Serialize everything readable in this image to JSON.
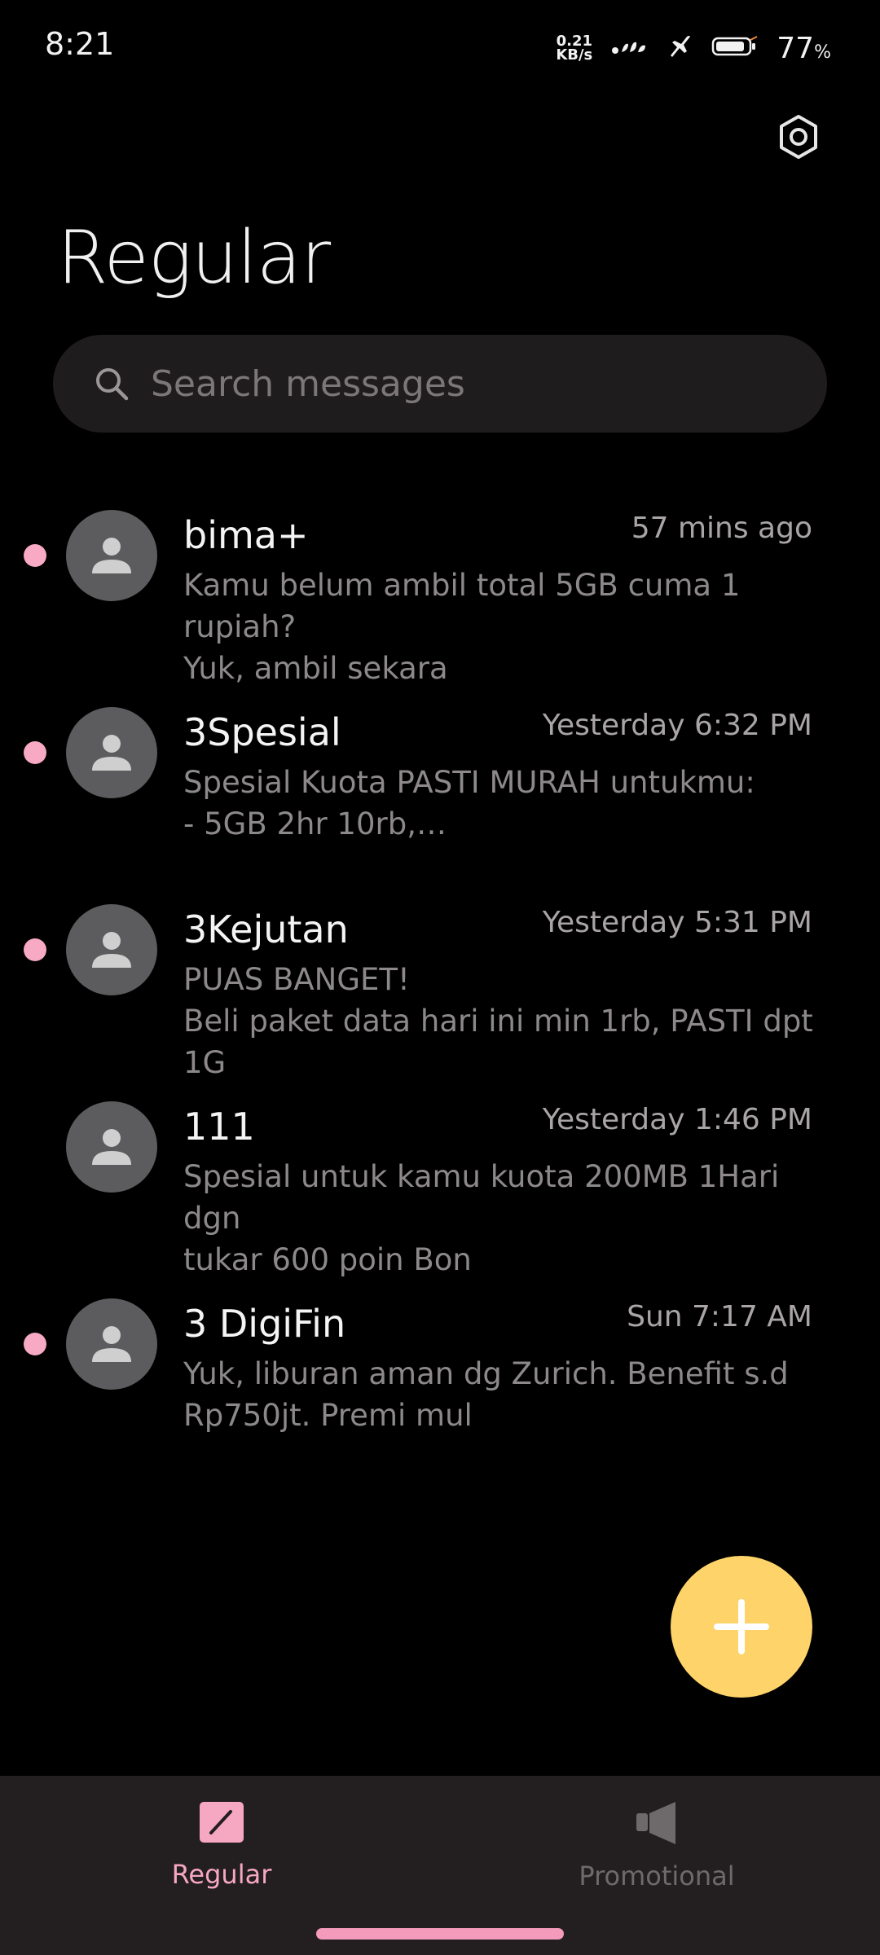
{
  "status_bar": {
    "time": "8:21",
    "net_speed_value": "0.21",
    "net_speed_unit": "KB/s",
    "battery_percent": "77",
    "battery_unit": "%",
    "icons": [
      "signal-icon",
      "airplane-icon",
      "battery-icon"
    ]
  },
  "header": {
    "title": "Regular",
    "settings_icon": "gear-icon"
  },
  "search": {
    "placeholder": "Search messages",
    "value": ""
  },
  "conversations": [
    {
      "name": "bima+",
      "time": "57 mins ago",
      "snippet": "Kamu belum ambil total 5GB cuma 1 rupiah?\nYuk, ambil sekara",
      "unread": true
    },
    {
      "name": "3Spesial",
      "time": "Yesterday 6:32 PM",
      "snippet": "Spesial Kuota PASTI MURAH untukmu:\n- 5GB 2hr 10rb,…",
      "unread": true
    },
    {
      "name": "3Kejutan",
      "time": "Yesterday 5:31 PM",
      "snippet": "PUAS BANGET!\nBeli paket data hari ini min 1rb, PASTI dpt 1G",
      "unread": true
    },
    {
      "name": "111",
      "time": "Yesterday 1:46 PM",
      "snippet": "Spesial untuk kamu kuota 200MB 1Hari dgn\ntukar 600 poin Bon",
      "unread": false
    },
    {
      "name": "3 DigiFin",
      "time": "Sun 7:17 AM",
      "snippet": "Yuk, liburan aman dg Zurich. Benefit s.d\nRp750jt. Premi mul",
      "unread": true
    }
  ],
  "fab": {
    "icon": "plus-icon"
  },
  "bottom_nav": {
    "tabs": [
      {
        "label": "Regular",
        "icon": "compose-icon",
        "active": true
      },
      {
        "label": "Promotional",
        "icon": "megaphone-icon",
        "active": false
      }
    ]
  },
  "colors": {
    "background": "#000000",
    "accent_pink": "#f6a7c1",
    "fab_yellow": "#fdd36a",
    "search_bg": "#1f1c1d",
    "nav_bg": "#231e20"
  }
}
